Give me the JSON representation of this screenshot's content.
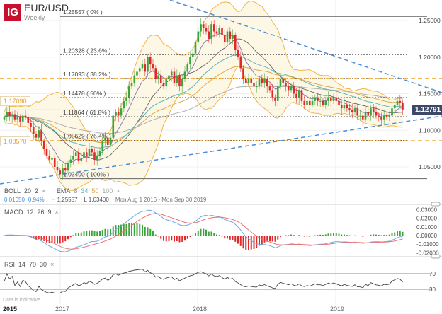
{
  "header": {
    "logo": "IG",
    "symbol": "EUR/USD",
    "interval": "Weekly"
  },
  "indicators": {
    "boll": {
      "name": "BOLL",
      "period": "20",
      "dev": "2"
    },
    "ema": {
      "name": "EMA",
      "p1": "8",
      "p2": "34",
      "p3": "50",
      "p4": "100"
    },
    "macd": {
      "name": "MACD",
      "fast": "12",
      "slow": "26",
      "signal": "9"
    },
    "rsi": {
      "name": "RSI",
      "period": "14",
      "upper": "70",
      "lower": "30"
    },
    "close_icon": "×"
  },
  "stats": {
    "change": "0.01050",
    "change_pct": "0.94%",
    "high": "H 1.25557",
    "low": "L 1.03400",
    "range": "Mon Aug 1 2016 - Mon Sep 30 2019"
  },
  "footer_note": "Data is indicative",
  "current_price": "1.12791",
  "levels": {
    "upper": "1.17090",
    "lower": "1.08570"
  },
  "colors": {
    "up": "#3aa53a",
    "down": "#e0282a",
    "boll": "#f3b545",
    "ema8": "#8c80b5",
    "ema34": "#5db8b2",
    "ema50": "#e3a648",
    "ema100": "#b0b0b0",
    "trend": "#4a90d9",
    "level": "#f0a020",
    "macd": "#6fa8e0",
    "signal": "#f07070"
  },
  "chart_data": {
    "type": "candlestick",
    "price_axis": {
      "ticks": [
        "1.25000",
        "1.20000",
        "1.15000",
        "1.10000",
        "1.05000"
      ],
      "values": [
        1.25,
        1.2,
        1.15,
        1.1,
        1.05
      ]
    },
    "x_ticks": [
      "2015",
      "2017",
      "2018",
      "2019"
    ],
    "fib": [
      {
        "label": "1.25557 ( 0% )",
        "value": 1.25557
      },
      {
        "label": "1.20328 ( 23.6% )",
        "value": 1.20328
      },
      {
        "label": "1.17093 ( 38.2% )",
        "value": 1.17093
      },
      {
        "label": "1.14478 ( 50% )",
        "value": 1.14478
      },
      {
        "label": "1.11864 ( 61.8% )",
        "value": 1.11864
      },
      {
        "label": "1.08629 ( 76.4% )",
        "value": 1.08629
      },
      {
        "label": "1.03400 ( 100% )",
        "value": 1.034
      }
    ],
    "horizontal_levels": [
      1.1709,
      1.0857
    ],
    "closes": [
      1.118,
      1.125,
      1.12,
      1.122,
      1.115,
      1.118,
      1.112,
      1.12,
      1.118,
      1.11,
      1.105,
      1.095,
      1.09,
      1.1,
      1.085,
      1.075,
      1.065,
      1.06,
      1.062,
      1.05,
      1.045,
      1.04,
      1.048,
      1.045,
      1.055,
      1.06,
      1.065,
      1.07,
      1.058,
      1.062,
      1.07,
      1.065,
      1.075,
      1.07,
      1.06,
      1.065,
      1.072,
      1.085,
      1.09,
      1.08,
      1.09,
      1.12,
      1.125,
      1.12,
      1.13,
      1.14,
      1.145,
      1.16,
      1.165,
      1.175,
      1.18,
      1.185,
      1.19,
      1.18,
      1.2,
      1.19,
      1.185,
      1.17,
      1.175,
      1.165,
      1.16,
      1.17,
      1.175,
      1.18,
      1.165,
      1.175,
      1.16,
      1.17,
      1.18,
      1.19,
      1.2,
      1.205,
      1.22,
      1.235,
      1.245,
      1.24,
      1.235,
      1.225,
      1.245,
      1.235,
      1.232,
      1.24,
      1.23,
      1.22,
      1.235,
      1.225,
      1.23,
      1.21,
      1.2,
      1.185,
      1.17,
      1.165,
      1.17,
      1.165,
      1.16,
      1.16,
      1.17,
      1.165,
      1.17,
      1.16,
      1.155,
      1.145,
      1.14,
      1.16,
      1.17,
      1.165,
      1.16,
      1.155,
      1.16,
      1.15,
      1.145,
      1.155,
      1.14,
      1.135,
      1.14,
      1.135,
      1.14,
      1.145,
      1.14,
      1.14,
      1.135,
      1.14,
      1.145,
      1.14,
      1.145,
      1.14,
      1.135,
      1.13,
      1.135,
      1.13,
      1.128,
      1.125,
      1.13,
      1.12,
      1.12,
      1.115,
      1.125,
      1.12,
      1.13,
      1.125,
      1.12,
      1.118,
      1.115,
      1.12,
      1.118,
      1.12,
      1.13,
      1.135,
      1.14,
      1.138,
      1.12791
    ],
    "macd_axis": {
      "ticks": [
        "0.03000",
        "0.02000",
        "0.01000",
        "0.00000",
        "-0.01000",
        "-0.02000"
      ],
      "values": [
        0.03,
        0.02,
        0.01,
        0,
        -0.01,
        -0.02
      ]
    },
    "rsi_axis": {
      "ticks": [
        "70",
        "30"
      ],
      "values": [
        70,
        30
      ]
    }
  }
}
